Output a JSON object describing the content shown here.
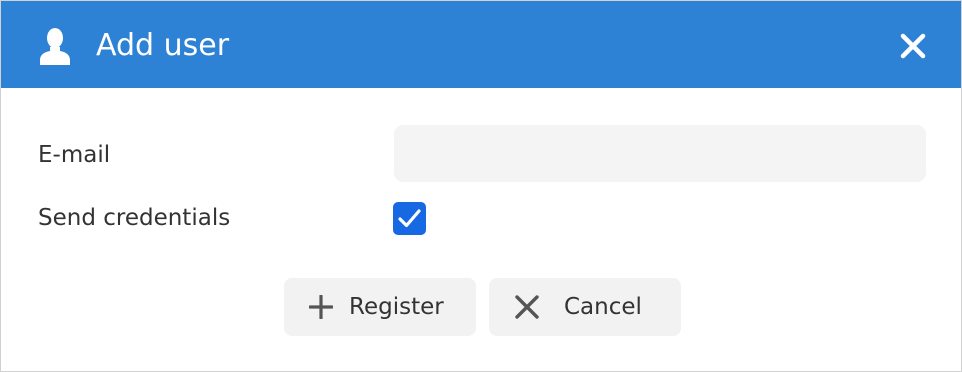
{
  "dialog": {
    "title": "Add user",
    "title_icon": "user-icon",
    "close_icon": "close-icon",
    "header_color": "#2e82d6"
  },
  "form": {
    "email_label": "E-mail",
    "email_value": "",
    "email_placeholder": "",
    "send_credentials_label": "Send credentials",
    "send_credentials_checked": true,
    "checkbox_color": "#1668e3"
  },
  "buttons": {
    "register": {
      "label": "Register",
      "icon": "plus-icon"
    },
    "cancel": {
      "label": "Cancel",
      "icon": "x-icon"
    }
  }
}
